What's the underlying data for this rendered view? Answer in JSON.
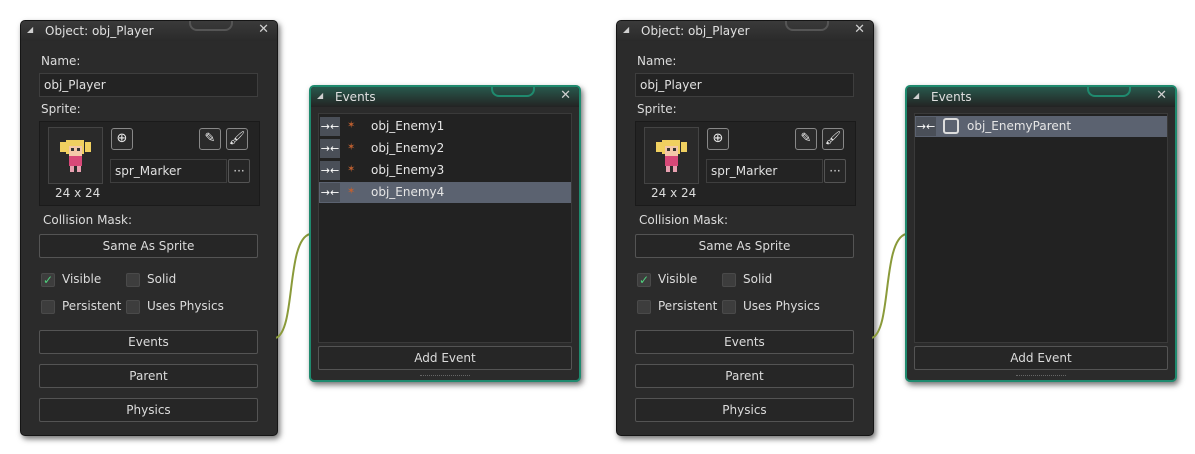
{
  "left": {
    "object_window": {
      "title": "Object: obj_Player",
      "name_label": "Name:",
      "name_value": "obj_Player",
      "sprite_label": "Sprite:",
      "sprite_name": "spr_Marker",
      "sprite_size": "24 x 24",
      "browse_label": "···",
      "collision_label": "Collision Mask:",
      "collision_value": "Same As Sprite",
      "visible_label": "Visible",
      "solid_label": "Solid",
      "persistent_label": "Persistent",
      "uses_physics_label": "Uses Physics",
      "events_button": "Events",
      "parent_button": "Parent",
      "physics_button": "Physics",
      "visible_checked": true,
      "solid_checked": false,
      "persistent_checked": false,
      "uses_physics_checked": false
    },
    "events_window": {
      "title": "Events",
      "items": [
        {
          "name": "obj_Enemy1",
          "selected": false
        },
        {
          "name": "obj_Enemy2",
          "selected": false
        },
        {
          "name": "obj_Enemy3",
          "selected": false
        },
        {
          "name": "obj_Enemy4",
          "selected": true
        }
      ],
      "add_event": "Add Event"
    }
  },
  "right": {
    "object_window": {
      "title": "Object: obj_Player",
      "name_label": "Name:",
      "name_value": "obj_Player",
      "sprite_label": "Sprite:",
      "sprite_name": "spr_Marker",
      "sprite_size": "24 x 24",
      "browse_label": "···",
      "collision_label": "Collision Mask:",
      "collision_value": "Same As Sprite",
      "visible_label": "Visible",
      "solid_label": "Solid",
      "persistent_label": "Persistent",
      "uses_physics_label": "Uses Physics",
      "events_button": "Events",
      "parent_button": "Parent",
      "physics_button": "Physics",
      "visible_checked": true,
      "solid_checked": false,
      "persistent_checked": false,
      "uses_physics_checked": false
    },
    "events_window": {
      "title": "Events",
      "items": [
        {
          "name": "obj_EnemyParent",
          "selected": true
        }
      ],
      "add_event": "Add Event"
    }
  },
  "icons": {
    "collision_event": "collision-event-icon",
    "enemy_sprite": "enemy-sprite-icon",
    "parent_object": "parent-object-icon",
    "new_sprite": "new-sprite-icon",
    "edit_image": "edit-image-icon",
    "paint_brush": "paint-brush-icon",
    "close": "close-icon",
    "collapse": "collapse-triangle-icon"
  },
  "colors": {
    "panel_bg": "#2b2b2b",
    "events_border": "#1f8a6e",
    "selection": "#5b6270",
    "check_green": "#4fd17d",
    "link_line": "#8a9a3a"
  }
}
